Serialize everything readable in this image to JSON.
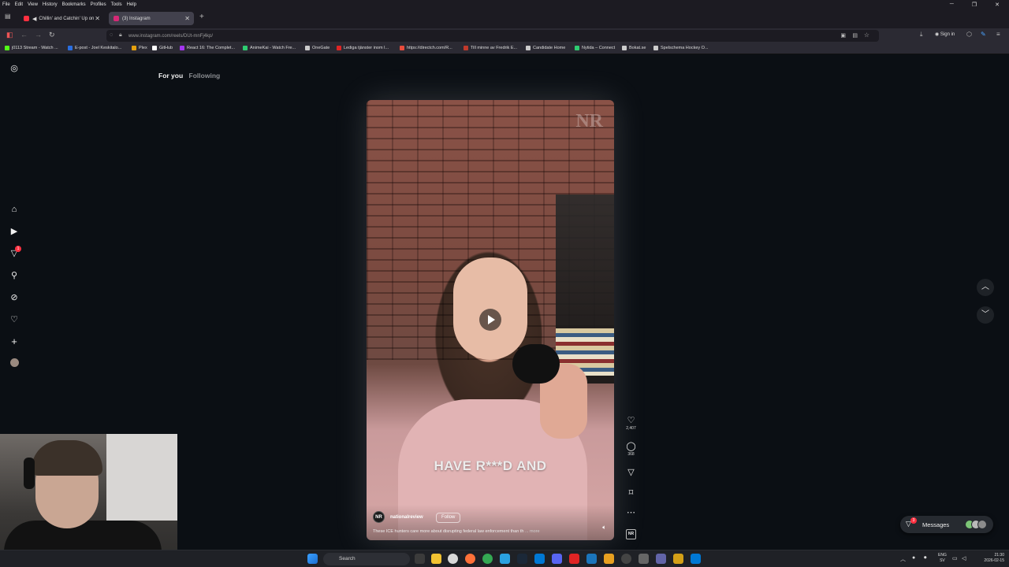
{
  "menubar": {
    "items": [
      "File",
      "Edit",
      "View",
      "History",
      "Bookmarks",
      "Profiles",
      "Tools",
      "Help"
    ]
  },
  "tabs": [
    {
      "label": "Chillin' and Catchin' Up on",
      "color": "#ff3040"
    },
    {
      "label": "(3) Instagram",
      "color": "#d62976"
    }
  ],
  "navbar": {
    "url": "www.instagram.com/reels/DUt-mnFj4kp/",
    "sign_in": "Sign in"
  },
  "bookmarks": [
    {
      "label": "j0113 Stream - Watch ...",
      "color": "#53fc18"
    },
    {
      "label": "E-post - Joel Keskitalo...",
      "color": "#2a6ee0"
    },
    {
      "label": "Plex",
      "color": "#e5a00d"
    },
    {
      "label": "GitHub",
      "color": "#ffffff"
    },
    {
      "label": "React 16: The Complet...",
      "color": "#a435f0"
    },
    {
      "label": "AnimeKai - Watch Fre...",
      "color": "#2ecc71"
    },
    {
      "label": "OneGate",
      "color": "#cccccc"
    },
    {
      "label": "Lediga tjänster inom I...",
      "color": "#e02424"
    },
    {
      "label": "https://directch.com/R...",
      "color": "#e74c3c"
    },
    {
      "label": "Till minne av Fredrik E...",
      "color": "#c0392b"
    },
    {
      "label": "Candidate Home",
      "color": "#cccccc"
    },
    {
      "label": "Nytida – Connect",
      "color": "#2ecc71"
    },
    {
      "label": "Bokat.se",
      "color": "#cccccc"
    },
    {
      "label": "Spelschema Hockey O...",
      "color": "#cccccc"
    }
  ],
  "sidebar": {
    "notification_count": "1"
  },
  "feed_tabs": {
    "active": "For you",
    "inactive": "Following"
  },
  "video": {
    "watermark": "NR",
    "caption_overlay": "HAVE R***D AND",
    "account_avatar": "NR",
    "account_name": "nationalreview",
    "follow_label": "Follow",
    "description": "These ICE hunters care more about disrupting federal law enforcement than th",
    "more_label": "... more"
  },
  "actions": {
    "likes": "2,407",
    "comments": "368",
    "badge": "NR"
  },
  "messages": {
    "label": "Messages",
    "badge": "3"
  },
  "taskbar": {
    "search_placeholder": "Search",
    "lang1": "ENG",
    "lang2": "SV",
    "time": "21:30",
    "date": "2026-02-15"
  }
}
